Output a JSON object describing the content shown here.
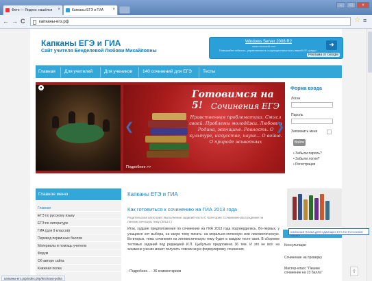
{
  "browser": {
    "tabs": [
      {
        "label": "Фото — Яндекс: нашёлся"
      },
      {
        "label": "Капканы ЕГЭ и ГИА"
      }
    ],
    "url": "капканы-егэ.рф",
    "status_url": "капканы-егэ.рф/index.php/kniznaya-polka"
  },
  "site": {
    "title": "Капканы ЕГЭ и ГИА",
    "subtitle": "Сайт учителя Бенделевой Любови Михайловны"
  },
  "ad": {
    "title": "Windows Server 2008 R2",
    "domain": "www.microsoft.com",
    "text": "Повышайте гибкость, управляемость и функциональность вашей ИТ-среды!",
    "google": "Реклама от Google",
    "arrow": "➜"
  },
  "nav": {
    "items": [
      "Главная",
      "Для учителей",
      "Для учеников",
      "140 сочинений для ЕГЭ",
      "Тесты"
    ]
  },
  "slider": {
    "heading1": "Готовимся на 5!",
    "heading2": "Сочинения ЕГЭ",
    "body": "Нравственная проблематика. Смысл своей. Проблемы молодёжи. Любовь и Родина, женщине. Ревность. О культуре, искусстве, науке... О войне. О природе животных",
    "caption": "Подробнее >>",
    "prev": "❮",
    "next": "❯"
  },
  "login": {
    "title": "Форма входа",
    "login_label": "Логин",
    "password_label": "Пароль",
    "remember_label": "Запомнить меня",
    "submit": "Войти",
    "forgot_password": "Забыли пароль?",
    "forgot_login": "Забыли логин?",
    "register": "Регистрация"
  },
  "menu": {
    "title": "Главное меню",
    "items": [
      "Главная",
      "ЕГЭ по русскому языку",
      "ЕГЭ по литературе",
      "ГИА (для 9 классов)",
      "Перевод первичных баллов",
      "Материалы в помощь учителю",
      "Форум",
      "Об авторе сайта",
      "Книжная полка"
    ]
  },
  "article": {
    "section": "Капканы ЕГЭ и ГИА",
    "title": "Как готовиться к сочинению на ГИА 2013 года",
    "meta": "Родительская категория: Выполнение заданий части С Категория: Сочинение-рассуждение на лингвистическую тему (2013 г.)",
    "text": "Итак, худшие предположения по сочинению на ГИА 2013 года подтвердились. Во-первых, у учащихся нет выбора, на какую тему писать: на морально-этическую или лингвистическую. Во-вторых, тема сочинения на лингвистическую тему будет в каждом тесте своя. В сборнике тестовых заданий под редакцией И.П. Цыбулько предложено 36 тем. И это не всё: на экзамене ученик может получить совсем иную формулировку сочинения.",
    "more": "Подробнее...",
    "comments": "36 комментариев"
  },
  "right_column": {
    "tooltip": "КНИЖНАЯ ПОЛКА ДЛЯ СДАЮЩИХ ЕГЭ ПО РУССКОМУ ЯЗЫКУ",
    "links": [
      "Консультации",
      "Сочинение на проверку",
      "Мастер-класс \"Пишем сочинение на 23 балла\""
    ]
  },
  "toolbar": {
    "back": "←",
    "forward": "→",
    "reload": "C",
    "star": "☆",
    "wrench": "≡"
  }
}
